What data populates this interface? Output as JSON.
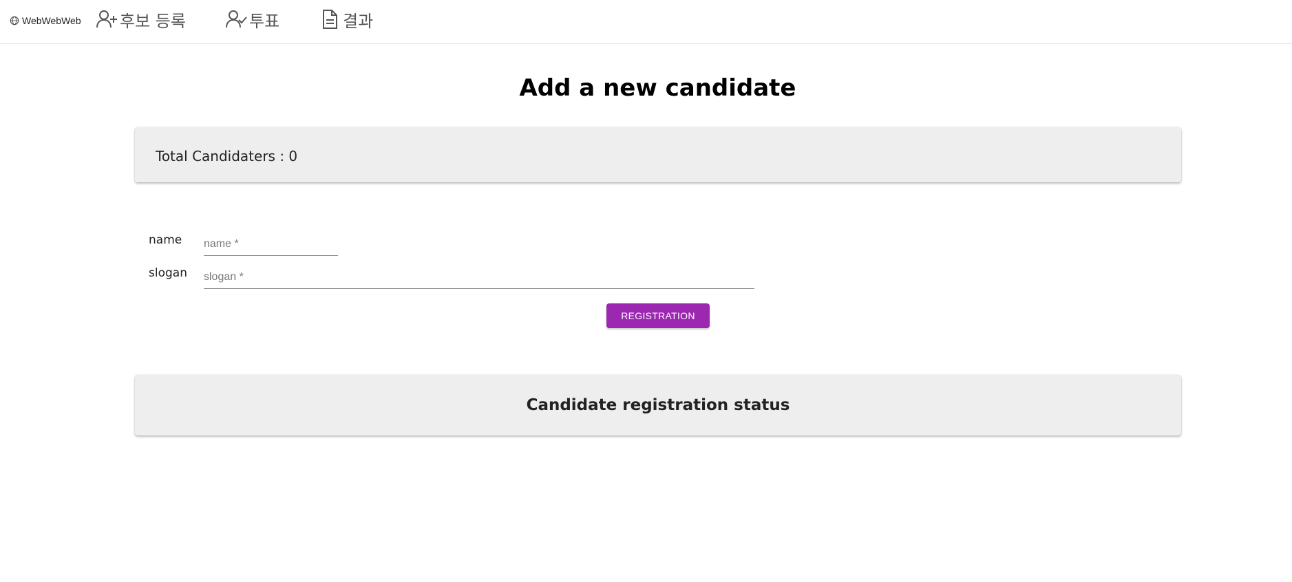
{
  "nav": {
    "brand": "WebWebWeb",
    "items": [
      {
        "label": "후보 등록",
        "icon": "person-add-icon"
      },
      {
        "label": "투표",
        "icon": "person-check-icon"
      },
      {
        "label": "결과",
        "icon": "document-icon"
      }
    ]
  },
  "page": {
    "title": "Add a new candidate"
  },
  "summary": {
    "total_label": "Total Candidaters : 0"
  },
  "form": {
    "name_label": "name",
    "name_placeholder": "name *",
    "slogan_label": "slogan",
    "slogan_placeholder": "slogan *",
    "submit_label": "REGISTRATION"
  },
  "status": {
    "heading": "Candidate registration status"
  },
  "colors": {
    "accent": "#9c27b0",
    "card_bg": "#eeeeee"
  }
}
